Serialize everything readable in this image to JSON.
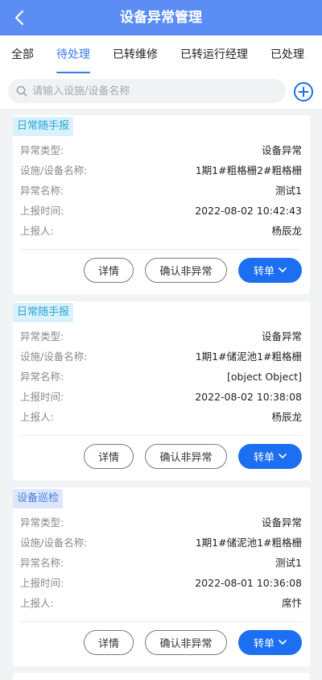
{
  "header": {
    "title": "设备异常管理",
    "back_icon": "chevron-left-icon"
  },
  "tabs": [
    {
      "label": "全部",
      "active": false
    },
    {
      "label": "待处理",
      "active": true
    },
    {
      "label": "已转维修",
      "active": false
    },
    {
      "label": "已转运行经理",
      "active": false
    },
    {
      "label": "已处理",
      "active": false
    }
  ],
  "search": {
    "placeholder": "请输入设施/设备名称",
    "value": "",
    "icon": "search-icon",
    "add_icon": "plus-circle-icon"
  },
  "colors": {
    "header_bg": "#5b8df5",
    "accent": "#3a7bea",
    "primary_button": "#1b6ff0"
  },
  "labels": {
    "type": "异常类型:",
    "facility": "设施/设备名称:",
    "name": "异常名称:",
    "time": "上报时间:",
    "reporter": "上报人:"
  },
  "buttons": {
    "detail": "详情",
    "confirm": "确认非异常",
    "transfer": "转单"
  },
  "records": [
    {
      "source": "日常随手报",
      "type": "设备异常",
      "facility": "1期1#粗格栅2#粗格栅",
      "name": "测试1",
      "time": "2022-08-02 10:42:43",
      "reporter": "杨辰龙"
    },
    {
      "source": "日常随手报",
      "type": "设备异常",
      "facility": "1期1#储泥池1#粗格栅",
      "name": "[object Object]",
      "time": "2022-08-02 10:38:08",
      "reporter": "杨辰龙"
    },
    {
      "source": "设备巡检",
      "type": "设备异常",
      "facility": "1期1#储泥池1#粗格栅",
      "name": "测试1",
      "time": "2022-08-01 10:36:08",
      "reporter": "席忭"
    }
  ]
}
